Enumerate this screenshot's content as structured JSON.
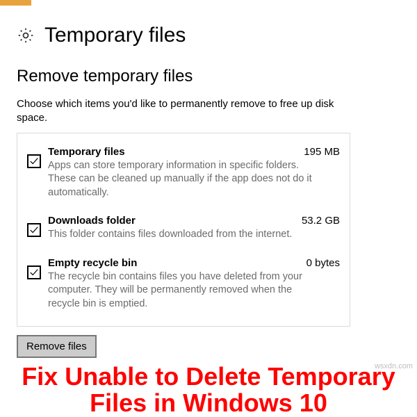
{
  "header": {
    "title": "Temporary files"
  },
  "section": {
    "title": "Remove temporary files",
    "description": "Choose which items you'd like to permanently remove to free up disk space."
  },
  "items": [
    {
      "title": "Temporary files",
      "size": "195 MB",
      "description": "Apps can store temporary information in specific folders. These can be cleaned up manually if the app does not do it automatically.",
      "checked": true
    },
    {
      "title": "Downloads folder",
      "size": "53.2 GB",
      "description": "This folder contains files downloaded from the internet.",
      "checked": true
    },
    {
      "title": "Empty recycle bin",
      "size": "0 bytes",
      "description": "The recycle bin contains files you have deleted from your computer. They will be permanently removed when the recycle bin is emptied.",
      "checked": true
    }
  ],
  "actions": {
    "remove_label": "Remove files"
  },
  "banner": {
    "line1": "Fix Unable to Delete Temporary",
    "line2": "Files in Windows 10"
  },
  "watermark": "wsxdn.com"
}
